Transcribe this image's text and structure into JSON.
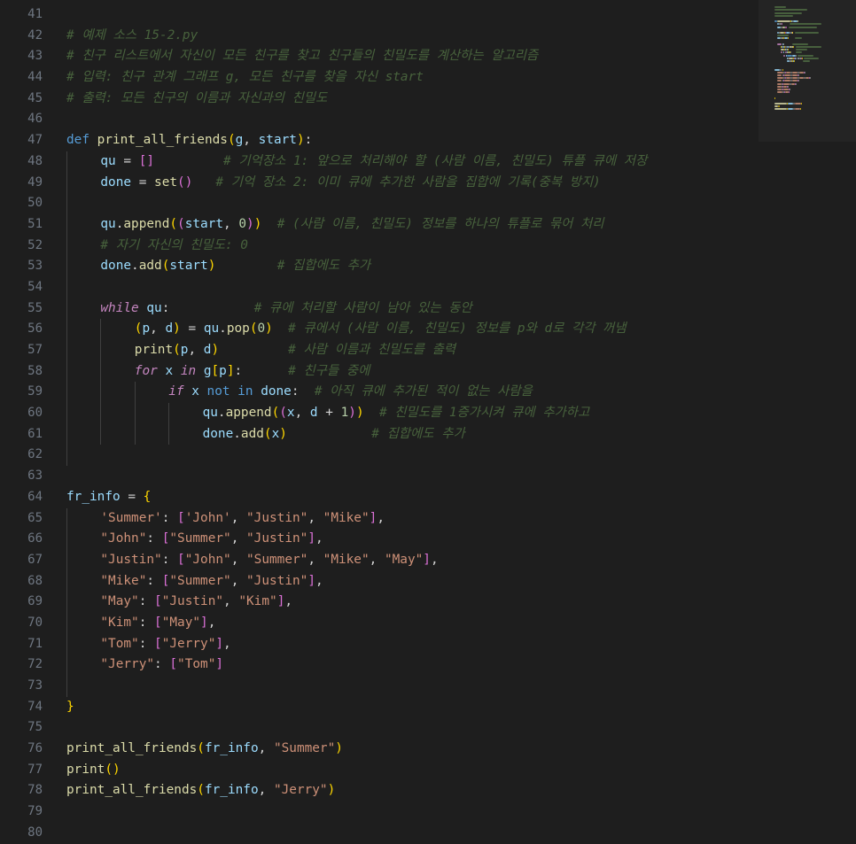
{
  "editor": {
    "language": "python",
    "lines": [
      {
        "no": "41",
        "indent": 0,
        "tokens": []
      },
      {
        "no": "42",
        "indent": 0,
        "tokens": [
          [
            "cm",
            "# 예제 소스 15-2.py"
          ]
        ]
      },
      {
        "no": "43",
        "indent": 0,
        "tokens": [
          [
            "cm",
            "# 친구 리스트에서 자신이 모든 친구를 찾고 친구들의 친밀도를 계산하는 알고리즘"
          ]
        ]
      },
      {
        "no": "44",
        "indent": 0,
        "tokens": [
          [
            "cm",
            "# 입력: 친구 관계 그래프 g, 모든 친구를 찾을 자신 start"
          ]
        ]
      },
      {
        "no": "45",
        "indent": 0,
        "tokens": [
          [
            "cm",
            "# 출력: 모든 친구의 이름과 자신과의 친밀도"
          ]
        ]
      },
      {
        "no": "46",
        "indent": 0,
        "tokens": []
      },
      {
        "no": "47",
        "indent": 0,
        "tokens": [
          [
            "kw",
            "def "
          ],
          [
            "fn",
            "print_all_friends"
          ],
          [
            "p1",
            "("
          ],
          [
            "var",
            "g"
          ],
          [
            "plain",
            ", "
          ],
          [
            "var",
            "start"
          ],
          [
            "p1",
            ")"
          ],
          [
            "plain",
            ":"
          ]
        ]
      },
      {
        "no": "48",
        "indent": 1,
        "tokens": [
          [
            "var",
            "qu"
          ],
          [
            "plain",
            " = "
          ],
          [
            "p2",
            "[]"
          ],
          [
            "plain",
            "         "
          ],
          [
            "cm",
            "# 기억장소 1: 앞으로 처리해야 할 (사람 이름, 친밀도) 튜플 큐에 저장"
          ]
        ]
      },
      {
        "no": "49",
        "indent": 1,
        "tokens": [
          [
            "var",
            "done"
          ],
          [
            "plain",
            " = "
          ],
          [
            "fn",
            "set"
          ],
          [
            "p2",
            "()"
          ],
          [
            "plain",
            "   "
          ],
          [
            "cm",
            "# 기억 장소 2: 이미 큐에 추가한 사람을 집합에 기록(중복 방지)"
          ]
        ]
      },
      {
        "no": "50",
        "indent": 1,
        "tokens": []
      },
      {
        "no": "51",
        "indent": 1,
        "tokens": [
          [
            "var",
            "qu"
          ],
          [
            "plain",
            "."
          ],
          [
            "fn",
            "append"
          ],
          [
            "p1",
            "("
          ],
          [
            "p2",
            "("
          ],
          [
            "var",
            "start"
          ],
          [
            "plain",
            ", "
          ],
          [
            "num",
            "0"
          ],
          [
            "p2",
            ")"
          ],
          [
            "p1",
            ")"
          ],
          [
            "plain",
            "  "
          ],
          [
            "cm",
            "# (사람 이름, 친밀도) 정보를 하나의 튜플로 묶어 처리"
          ]
        ]
      },
      {
        "no": "52",
        "indent": 1,
        "tokens": [
          [
            "cm",
            "# 자기 자신의 친밀도: 0"
          ]
        ]
      },
      {
        "no": "53",
        "indent": 1,
        "tokens": [
          [
            "var",
            "done"
          ],
          [
            "plain",
            "."
          ],
          [
            "fn",
            "add"
          ],
          [
            "p1",
            "("
          ],
          [
            "var",
            "start"
          ],
          [
            "p1",
            ")"
          ],
          [
            "plain",
            "        "
          ],
          [
            "cm",
            "# 집합에도 추가"
          ]
        ]
      },
      {
        "no": "54",
        "indent": 1,
        "tokens": []
      },
      {
        "no": "55",
        "indent": 1,
        "tokens": [
          [
            "ctl",
            "while"
          ],
          [
            "plain",
            " "
          ],
          [
            "var",
            "qu"
          ],
          [
            "plain",
            ":"
          ],
          [
            "plain",
            "           "
          ],
          [
            "cm",
            "# 큐에 처리할 사람이 남아 있는 동안"
          ]
        ]
      },
      {
        "no": "56",
        "indent": 2,
        "tokens": [
          [
            "p1",
            "("
          ],
          [
            "var",
            "p"
          ],
          [
            "plain",
            ", "
          ],
          [
            "var",
            "d"
          ],
          [
            "p1",
            ")"
          ],
          [
            "plain",
            " = "
          ],
          [
            "var",
            "qu"
          ],
          [
            "plain",
            "."
          ],
          [
            "fn",
            "pop"
          ],
          [
            "p1",
            "("
          ],
          [
            "num",
            "0"
          ],
          [
            "p1",
            ")"
          ],
          [
            "plain",
            "  "
          ],
          [
            "cm",
            "# 큐에서 (사람 이름, 친밀도) 정보를 p와 d로 각각 꺼냄"
          ]
        ]
      },
      {
        "no": "57",
        "indent": 2,
        "tokens": [
          [
            "fn",
            "print"
          ],
          [
            "p1",
            "("
          ],
          [
            "var",
            "p"
          ],
          [
            "plain",
            ", "
          ],
          [
            "var",
            "d"
          ],
          [
            "p1",
            ")"
          ],
          [
            "plain",
            "         "
          ],
          [
            "cm",
            "# 사람 이름과 친밀도를 출력"
          ]
        ]
      },
      {
        "no": "58",
        "indent": 2,
        "tokens": [
          [
            "ctl",
            "for"
          ],
          [
            "plain",
            " "
          ],
          [
            "var",
            "x"
          ],
          [
            "plain",
            " "
          ],
          [
            "ctl",
            "in"
          ],
          [
            "plain",
            " "
          ],
          [
            "var",
            "g"
          ],
          [
            "p1",
            "["
          ],
          [
            "var",
            "p"
          ],
          [
            "p1",
            "]"
          ],
          [
            "plain",
            ":"
          ],
          [
            "plain",
            "      "
          ],
          [
            "cm",
            "# 친구들 중에"
          ]
        ]
      },
      {
        "no": "59",
        "indent": 3,
        "tokens": [
          [
            "ctl",
            "if"
          ],
          [
            "plain",
            " "
          ],
          [
            "var",
            "x"
          ],
          [
            "plain",
            " "
          ],
          [
            "kw",
            "not in"
          ],
          [
            "plain",
            " "
          ],
          [
            "var",
            "done"
          ],
          [
            "plain",
            ":"
          ],
          [
            "plain",
            "  "
          ],
          [
            "cm",
            "# 아직 큐에 추가된 적이 없는 사람을"
          ]
        ]
      },
      {
        "no": "60",
        "indent": 4,
        "tokens": [
          [
            "var",
            "qu"
          ],
          [
            "plain",
            "."
          ],
          [
            "fn",
            "append"
          ],
          [
            "p1",
            "("
          ],
          [
            "p2",
            "("
          ],
          [
            "var",
            "x"
          ],
          [
            "plain",
            ", "
          ],
          [
            "var",
            "d"
          ],
          [
            "plain",
            " + "
          ],
          [
            "num",
            "1"
          ],
          [
            "p2",
            ")"
          ],
          [
            "p1",
            ")"
          ],
          [
            "plain",
            "  "
          ],
          [
            "cm",
            "# 친밀도를 1증가시켜 큐에 추가하고"
          ]
        ]
      },
      {
        "no": "61",
        "indent": 4,
        "tokens": [
          [
            "var",
            "done"
          ],
          [
            "plain",
            "."
          ],
          [
            "fn",
            "add"
          ],
          [
            "p1",
            "("
          ],
          [
            "var",
            "x"
          ],
          [
            "p1",
            ")"
          ],
          [
            "plain",
            "           "
          ],
          [
            "cm",
            "# 집합에도 추가"
          ]
        ]
      },
      {
        "no": "62",
        "indent": 1,
        "tokens": []
      },
      {
        "no": "63",
        "indent": 0,
        "tokens": []
      },
      {
        "no": "64",
        "indent": 0,
        "tokens": [
          [
            "var",
            "fr_info"
          ],
          [
            "plain",
            " = "
          ],
          [
            "p1",
            "{"
          ]
        ]
      },
      {
        "no": "65",
        "indent": 1,
        "tokens": [
          [
            "str",
            "'Summer'"
          ],
          [
            "plain",
            ": "
          ],
          [
            "p2",
            "["
          ],
          [
            "str",
            "'John'"
          ],
          [
            "plain",
            ", "
          ],
          [
            "str",
            "\"Justin\""
          ],
          [
            "plain",
            ", "
          ],
          [
            "str",
            "\"Mike\""
          ],
          [
            "p2",
            "]"
          ],
          [
            "plain",
            ","
          ]
        ]
      },
      {
        "no": "66",
        "indent": 1,
        "tokens": [
          [
            "str",
            "\"John\""
          ],
          [
            "plain",
            ": "
          ],
          [
            "p2",
            "["
          ],
          [
            "str",
            "\"Summer\""
          ],
          [
            "plain",
            ", "
          ],
          [
            "str",
            "\"Justin\""
          ],
          [
            "p2",
            "]"
          ],
          [
            "plain",
            ","
          ]
        ]
      },
      {
        "no": "67",
        "indent": 1,
        "tokens": [
          [
            "str",
            "\"Justin\""
          ],
          [
            "plain",
            ": "
          ],
          [
            "p2",
            "["
          ],
          [
            "str",
            "\"John\""
          ],
          [
            "plain",
            ", "
          ],
          [
            "str",
            "\"Summer\""
          ],
          [
            "plain",
            ", "
          ],
          [
            "str",
            "\"Mike\""
          ],
          [
            "plain",
            ", "
          ],
          [
            "str",
            "\"May\""
          ],
          [
            "p2",
            "]"
          ],
          [
            "plain",
            ","
          ]
        ]
      },
      {
        "no": "68",
        "indent": 1,
        "tokens": [
          [
            "str",
            "\"Mike\""
          ],
          [
            "plain",
            ": "
          ],
          [
            "p2",
            "["
          ],
          [
            "str",
            "\"Summer\""
          ],
          [
            "plain",
            ", "
          ],
          [
            "str",
            "\"Justin\""
          ],
          [
            "p2",
            "]"
          ],
          [
            "plain",
            ","
          ]
        ]
      },
      {
        "no": "69",
        "indent": 1,
        "tokens": [
          [
            "str",
            "\"May\""
          ],
          [
            "plain",
            ": "
          ],
          [
            "p2",
            "["
          ],
          [
            "str",
            "\"Justin\""
          ],
          [
            "plain",
            ", "
          ],
          [
            "str",
            "\"Kim\""
          ],
          [
            "p2",
            "]"
          ],
          [
            "plain",
            ","
          ]
        ]
      },
      {
        "no": "70",
        "indent": 1,
        "tokens": [
          [
            "str",
            "\"Kim\""
          ],
          [
            "plain",
            ": "
          ],
          [
            "p2",
            "["
          ],
          [
            "str",
            "\"May\""
          ],
          [
            "p2",
            "]"
          ],
          [
            "plain",
            ","
          ]
        ]
      },
      {
        "no": "71",
        "indent": 1,
        "tokens": [
          [
            "str",
            "\"Tom\""
          ],
          [
            "plain",
            ": "
          ],
          [
            "p2",
            "["
          ],
          [
            "str",
            "\"Jerry\""
          ],
          [
            "p2",
            "]"
          ],
          [
            "plain",
            ","
          ]
        ]
      },
      {
        "no": "72",
        "indent": 1,
        "tokens": [
          [
            "str",
            "\"Jerry\""
          ],
          [
            "plain",
            ": "
          ],
          [
            "p2",
            "["
          ],
          [
            "str",
            "\"Tom\""
          ],
          [
            "p2",
            "]"
          ]
        ]
      },
      {
        "no": "73",
        "indent": 1,
        "tokens": []
      },
      {
        "no": "74",
        "indent": 0,
        "tokens": [
          [
            "p1",
            "}"
          ]
        ]
      },
      {
        "no": "75",
        "indent": 0,
        "tokens": []
      },
      {
        "no": "76",
        "indent": 0,
        "tokens": [
          [
            "fn",
            "print_all_friends"
          ],
          [
            "p1",
            "("
          ],
          [
            "var",
            "fr_info"
          ],
          [
            "plain",
            ", "
          ],
          [
            "str",
            "\"Summer\""
          ],
          [
            "p1",
            ")"
          ]
        ]
      },
      {
        "no": "77",
        "indent": 0,
        "tokens": [
          [
            "fn",
            "print"
          ],
          [
            "p1",
            "()"
          ]
        ]
      },
      {
        "no": "78",
        "indent": 0,
        "tokens": [
          [
            "fn",
            "print_all_friends"
          ],
          [
            "p1",
            "("
          ],
          [
            "var",
            "fr_info"
          ],
          [
            "plain",
            ", "
          ],
          [
            "str",
            "\"Jerry\""
          ],
          [
            "p1",
            ")"
          ]
        ]
      },
      {
        "no": "79",
        "indent": 0,
        "tokens": []
      },
      {
        "no": "80",
        "indent": 0,
        "tokens": []
      }
    ]
  },
  "colors": {
    "background": "#1e1e1e",
    "line_number": "#6e7681",
    "keyword": "#569cd6",
    "control": "#c586c0",
    "function": "#dcdcaa",
    "variable": "#9cdcfe",
    "string": "#ce9178",
    "number": "#b5cea8",
    "comment": "#6a9955",
    "bracket_1": "#ffd700",
    "bracket_2": "#da70d6"
  }
}
